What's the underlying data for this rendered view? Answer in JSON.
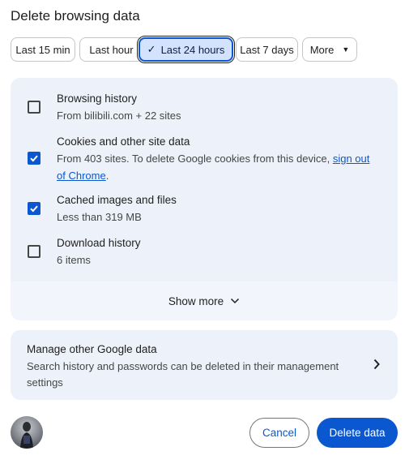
{
  "dialog": {
    "title": "Delete browsing data"
  },
  "time_ranges": [
    {
      "label": "Last 15 min",
      "selected": false
    },
    {
      "label": "Last hour",
      "selected": false
    },
    {
      "label": "Last 24 hours",
      "selected": true
    },
    {
      "label": "Last 7 days",
      "selected": false
    },
    {
      "label": "More",
      "selected": false
    }
  ],
  "items": [
    {
      "title": "Browsing history",
      "subtitle": "From bilibili.com + 22 sites",
      "checked": false
    },
    {
      "title": "Cookies and other site data",
      "subtitle": "From 403 sites. To delete Google cookies from this device,",
      "link_text": "sign out of Chrome",
      "subtitle_end": ".",
      "checked": true
    },
    {
      "title": "Cached images and files",
      "subtitle": "Less than 319 MB",
      "checked": true
    },
    {
      "title": "Download history",
      "subtitle": "6 items",
      "checked": false
    }
  ],
  "show_more": {
    "label": "Show more"
  },
  "manage": {
    "title": "Manage other Google data",
    "subtitle": "Search history and passwords can be deleted in their management settings"
  },
  "buttons": {
    "cancel": "Cancel",
    "delete": "Delete data"
  },
  "colors": {
    "accent": "#0b57d0",
    "panel": "#edf2fa"
  }
}
